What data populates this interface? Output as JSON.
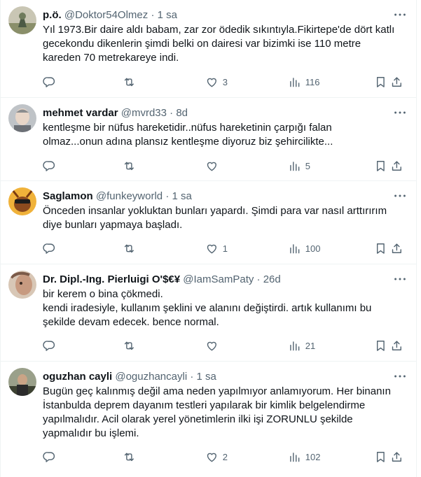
{
  "tweets": [
    {
      "name": "p.ö.",
      "handle": "@Doktor54Olmez",
      "dot": "·",
      "time": "1 sa",
      "lines": [
        "Yıl 1973.Bir daire aldı babam, zar zor ödedik sıkıntıyla.Fikirtepe'de dört katlı",
        "gecekondu dikenlerin şimdi belki on dairesi var bizimki ise 110 metre",
        "kareden 70 metrekareye indi."
      ],
      "replies": "",
      "retweets": "",
      "likes": "3",
      "views": "116"
    },
    {
      "name": "mehmet vardar",
      "handle": "@mvrd33",
      "dot": "·",
      "time": "8d",
      "lines": [
        "kentleşme bir nüfus hareketidir..nüfus hareketinin çarpığı falan",
        "olmaz...onun adına plansız kentleşme diyoruz biz şehircilikte..."
      ],
      "replies": "",
      "retweets": "",
      "likes": "",
      "views": "5"
    },
    {
      "name": "Saglamon",
      "handle": "@funkeyworld",
      "dot": "·",
      "time": "1 sa",
      "lines": [
        "Önceden insanlar yokluktan bunları yapardı. Şimdi para var nasıl arttırırım",
        "diye bunları yapmaya başladı."
      ],
      "replies": "",
      "retweets": "",
      "likes": "1",
      "views": "100"
    },
    {
      "name": "Dr. Dipl.-Ing. Pierluigi O'$€¥",
      "handle": "@IamSamPaty",
      "dot": "·",
      "time": "26d",
      "lines": [
        "bir kerem o bina çökmedi.",
        "kendi iradesiyle, kullanım şeklini ve alanını değiştirdi. artık kullanımı bu",
        "şekilde devam edecek. bence normal."
      ],
      "replies": "",
      "retweets": "",
      "likes": "",
      "views": "21"
    },
    {
      "name": "oguzhan cayli",
      "handle": "@oguzhancayli",
      "dot": "·",
      "time": "1 sa",
      "lines": [
        "Bugün geç kalınmış değil ama neden yapılmıyor anlamıyorum. Her binanın",
        "İstanbulda deprem dayanım testleri yapılarak bir kimlik belgelendirme",
        "yapılmalıdır. Acil olarak yerel yönetimlerin ilki işi ZORUNLU şekilde",
        "yapmalıdır bu işlemi."
      ],
      "replies": "",
      "retweets": "",
      "likes": "2",
      "views": "102"
    }
  ],
  "colors": {
    "text": "#0f1419",
    "secondary": "#536471",
    "border": "#eff3f4"
  },
  "icons": [
    "more-icon",
    "reply-icon",
    "retweet-icon",
    "like-icon",
    "views-icon",
    "bookmark-icon",
    "share-icon"
  ]
}
